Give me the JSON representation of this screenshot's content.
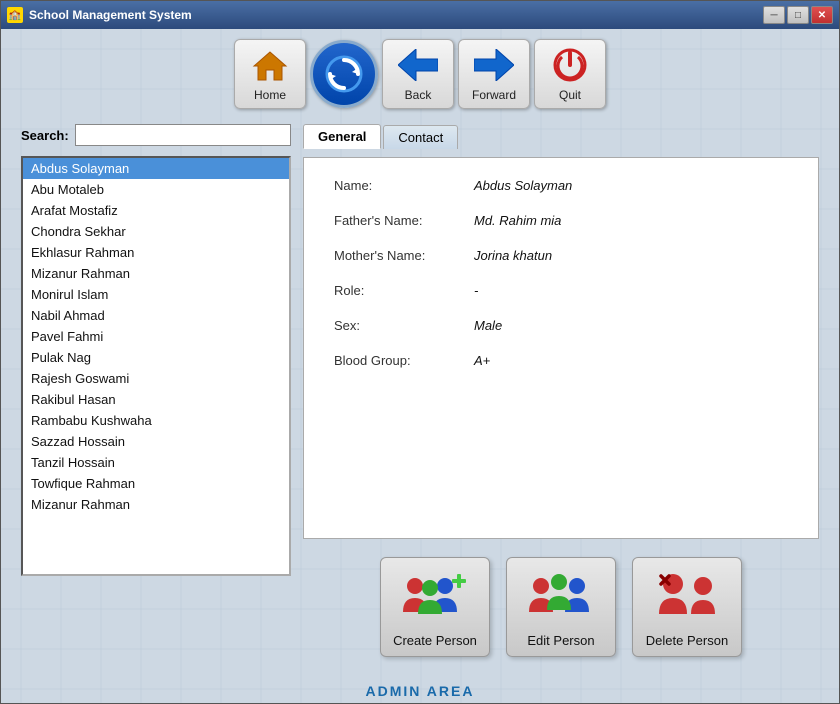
{
  "window": {
    "title": "School Management System",
    "icon": "🏫"
  },
  "toolbar": {
    "buttons": [
      {
        "id": "home",
        "label": "Home",
        "icon": "🏠"
      },
      {
        "id": "refresh",
        "label": "Refresh",
        "icon": "🔄"
      },
      {
        "id": "back",
        "label": "Back",
        "icon": "◀"
      },
      {
        "id": "forward",
        "label": "Forward",
        "icon": "▶"
      },
      {
        "id": "quit",
        "label": "Quit",
        "icon": "⏻"
      }
    ]
  },
  "search": {
    "label": "Search:",
    "placeholder": ""
  },
  "persons": [
    {
      "name": "Abdus Solayman",
      "selected": true
    },
    {
      "name": "Abu Motaleb",
      "selected": false
    },
    {
      "name": "Arafat Mostafiz",
      "selected": false
    },
    {
      "name": "Chondra Sekhar",
      "selected": false
    },
    {
      "name": "Ekhlasur Rahman",
      "selected": false
    },
    {
      "name": "Mizanur Rahman",
      "selected": false
    },
    {
      "name": "Monirul Islam",
      "selected": false
    },
    {
      "name": "Nabil Ahmad",
      "selected": false
    },
    {
      "name": "Pavel Fahmi",
      "selected": false
    },
    {
      "name": "Pulak Nag",
      "selected": false
    },
    {
      "name": "Rajesh Goswami",
      "selected": false
    },
    {
      "name": "Rakibul Hasan",
      "selected": false
    },
    {
      "name": "Rambabu Kushwaha",
      "selected": false
    },
    {
      "name": "Sazzad Hossain",
      "selected": false
    },
    {
      "name": "Tanzil Hossain",
      "selected": false
    },
    {
      "name": "Towfique Rahman",
      "selected": false
    },
    {
      "name": "Mizanur Rahman",
      "selected": false
    }
  ],
  "tabs": [
    {
      "id": "general",
      "label": "General",
      "active": true
    },
    {
      "id": "contact",
      "label": "Contact",
      "active": false
    }
  ],
  "person_detail": {
    "name_label": "Name:",
    "name_value": "Abdus Solayman",
    "father_label": "Father's Name:",
    "father_value": "Md. Rahim mia",
    "mother_label": "Mother's Name:",
    "mother_value": "Jorina khatun",
    "role_label": "Role:",
    "role_value": "-",
    "sex_label": "Sex:",
    "sex_value": "Male",
    "blood_label": "Blood Group:",
    "blood_value": "A+"
  },
  "actions": [
    {
      "id": "create",
      "label": "Create Person"
    },
    {
      "id": "edit",
      "label": "Edit Person"
    },
    {
      "id": "delete",
      "label": "Delete Person"
    }
  ],
  "footer": {
    "text": "ADMIN AREA"
  },
  "titlebar": {
    "minimize": "─",
    "maximize": "□",
    "close": "✕"
  }
}
